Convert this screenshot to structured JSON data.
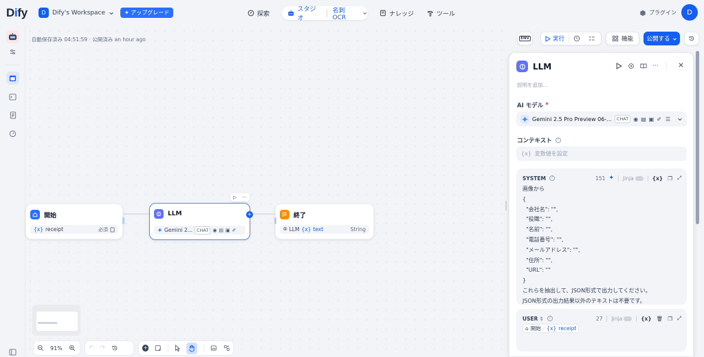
{
  "app": {
    "logo": "Dify"
  },
  "workspace": {
    "avatar": "D",
    "name": "Dify's Workspace",
    "upgrade_label": "アップグレード"
  },
  "nav": {
    "explore": "探索",
    "studio": "スタジオ",
    "app_name": "名刺OCR",
    "knowledge": "ナレッジ",
    "tools": "ツール"
  },
  "header_right": {
    "plugins": "プラグイン",
    "user_avatar": "D"
  },
  "status": {
    "autosave": "自動保存済み 04:51:59 · 公開済み an hour ago"
  },
  "toolbar": {
    "env_label": "ENV",
    "run_label": "実行",
    "features_label": "機能",
    "publish_label": "公開する"
  },
  "nodes": {
    "start": {
      "title": "開始",
      "var": "receipt",
      "var_prefix": "{x}",
      "meta": "必須"
    },
    "llm": {
      "title": "LLM",
      "model": "Gemini 2...",
      "chip": "CHAT"
    },
    "end": {
      "title": "終了",
      "source": "LLM",
      "var_prefix": "{x}",
      "var": "text",
      "type": "String"
    }
  },
  "panel": {
    "title": "LLM",
    "desc_placeholder": "説明を追加...",
    "ai_model_label": "AI モデル",
    "required_mark": "*",
    "model_name": "Gemini 2.5 Pro Preview 06-...",
    "model_chip": "CHAT",
    "context_label": "コンテキスト",
    "context_prefix": "{x}",
    "context_placeholder": "変数値を設定",
    "system": {
      "role": "SYSTEM",
      "count": "151",
      "jinja": "Jinja",
      "var_btn": "{x}",
      "text": "画像から\n{\n  \"会社名\": \"\",\n  \"役職\": \"\",\n  \"名前\": \"\",\n  \"電話番号\": \"\",\n  \"メールアドレス\": \"\",\n  \"住所\": \"\",\n  \"URL\": \"\"\n}\nこれらを抽出して、JSON形式で出力してください。\nJSON形式の出力結果以外のテキストは不要です。"
    },
    "user": {
      "role": "USER",
      "count": "27",
      "jinja": "Jinja",
      "var_btn": "{x}",
      "ref_node": "開始",
      "ref_prefix": "{x}",
      "ref_var": "receipt"
    }
  },
  "zoom": {
    "level": "91%"
  },
  "colors": {
    "accent": "#155eef",
    "start": "#2970ff",
    "llm": "#6172f3",
    "end": "#f79009"
  }
}
